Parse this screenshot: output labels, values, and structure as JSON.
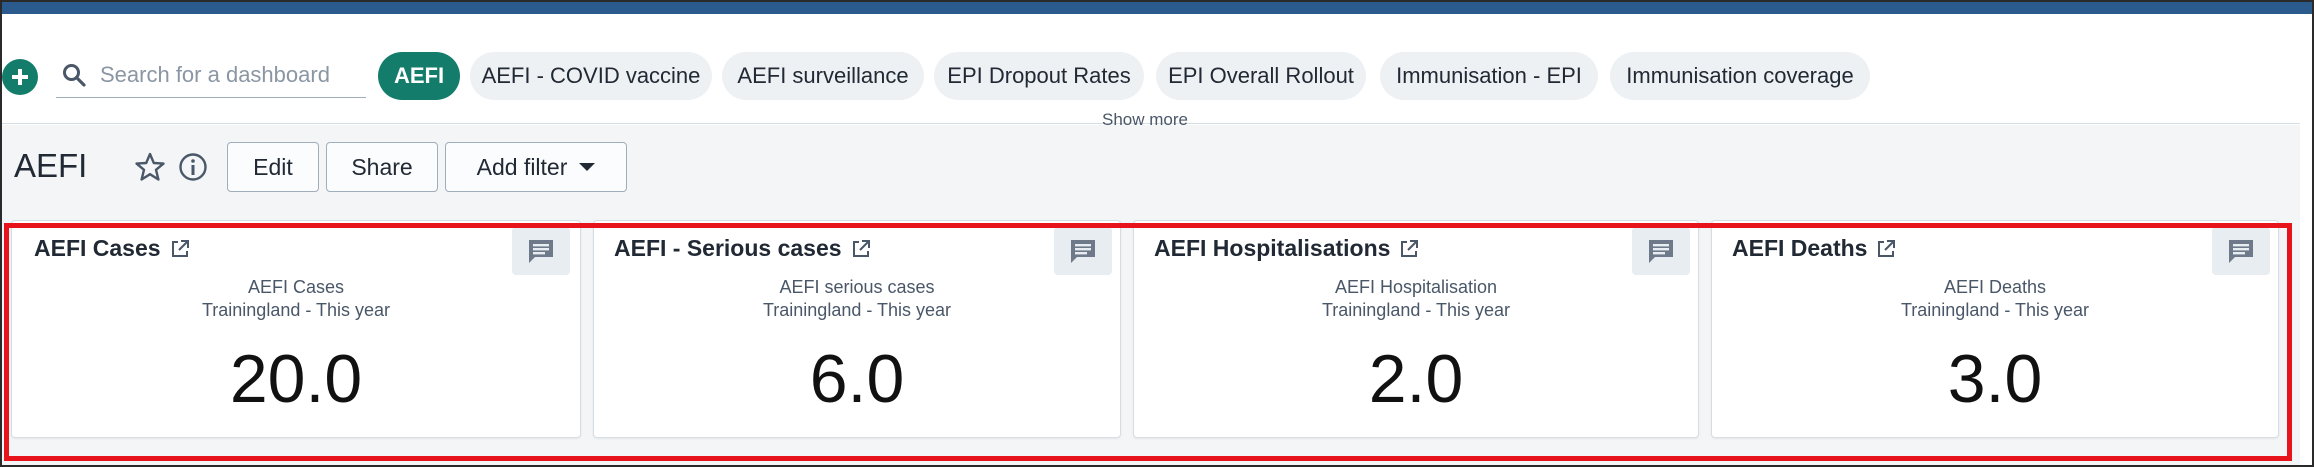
{
  "search": {
    "placeholder": "Search for a dashboard"
  },
  "chips": [
    {
      "label": "AEFI",
      "selected": true
    },
    {
      "label": "AEFI - COVID vaccine"
    },
    {
      "label": "AEFI surveillance"
    },
    {
      "label": "EPI Dropout Rates"
    },
    {
      "label": "EPI Overall Rollout"
    },
    {
      "label": "Immunisation - EPI"
    },
    {
      "label": "Immunisation coverage"
    }
  ],
  "show_more_label": "Show more",
  "dashboard": {
    "title": "AEFI",
    "edit_label": "Edit",
    "share_label": "Share",
    "add_filter_label": "Add filter"
  },
  "cards": [
    {
      "title": "AEFI Cases",
      "subtitle": "AEFI Cases",
      "period": "Trainingland - This year",
      "value": "20.0"
    },
    {
      "title": "AEFI - Serious cases",
      "subtitle": "AEFI serious cases",
      "period": "Trainingland - This year",
      "value": "6.0"
    },
    {
      "title": "AEFI Hospitalisations",
      "subtitle": "AEFI Hospitalisation",
      "period": "Trainingland - This year",
      "value": "2.0"
    },
    {
      "title": "AEFI Deaths",
      "subtitle": "AEFI Deaths",
      "period": "Trainingland - This year",
      "value": "3.0"
    }
  ],
  "colors": {
    "accent": "#147c6a",
    "highlight_border": "#e8141c",
    "chip_bg": "#eef1f4",
    "top_strip": "#2b5b8c"
  }
}
